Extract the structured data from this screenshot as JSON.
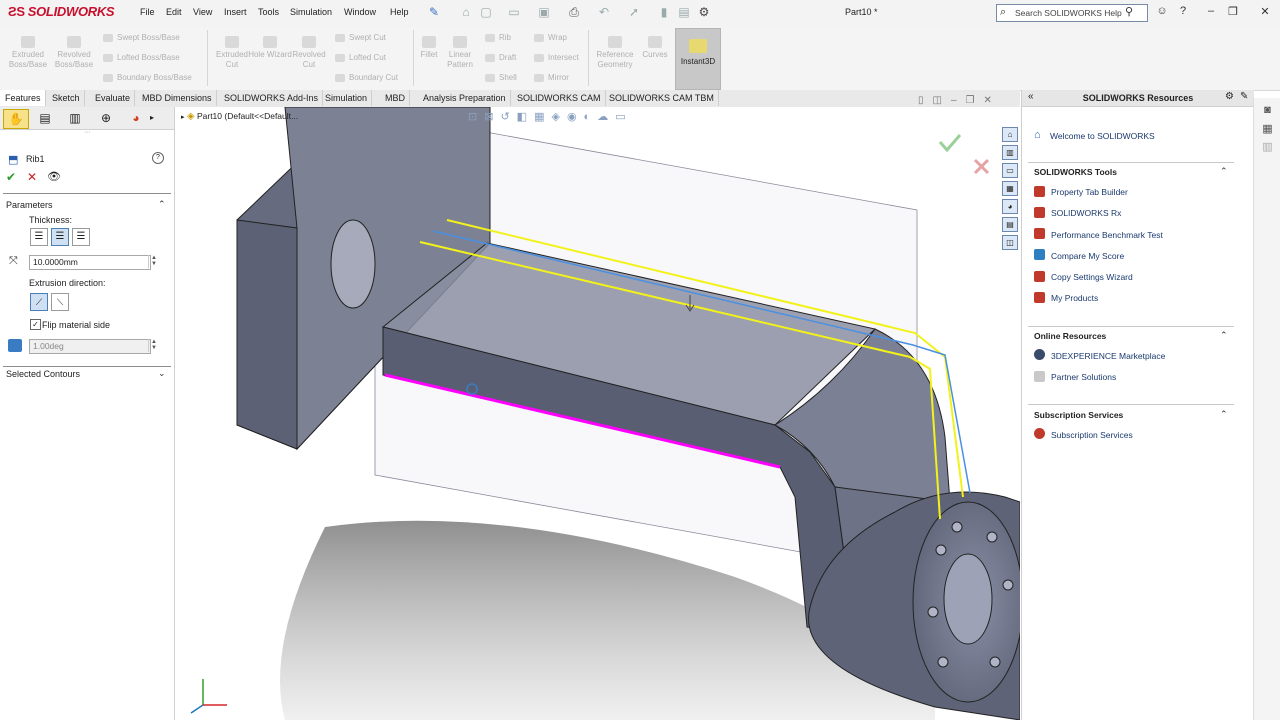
{
  "app": {
    "brand": "SOLIDWORKS",
    "brand_color": "#c8102e"
  },
  "menu": [
    "File",
    "Edit",
    "View",
    "Insert",
    "Tools",
    "Simulation",
    "Window",
    "Help"
  ],
  "document_title": "Part10 *",
  "search": {
    "placeholder": "Search SOLIDWORKS Help"
  },
  "commands": {
    "extruded_boss": "Extruded Boss/Base",
    "revolved_boss": "Revolved Boss/Base",
    "swept_boss": "Swept Boss/Base",
    "lofted_boss": "Lofted Boss/Base",
    "boundary_boss": "Boundary Boss/Base",
    "extruded_cut": "Extruded Cut",
    "hole_wizard": "Hole Wizard",
    "revolved_cut": "Revolved Cut",
    "swept_cut": "Swept Cut",
    "lofted_cut": "Lofted Cut",
    "boundary_cut": "Boundary Cut",
    "fillet": "Fillet",
    "linear_pattern": "Linear Pattern",
    "rib": "Rib",
    "draft": "Draft",
    "shell": "Shell",
    "wrap": "Wrap",
    "intersect": "Intersect",
    "mirror": "Mirror",
    "reference_geometry": "Reference Geometry",
    "curves": "Curves",
    "instant3d": "Instant3D"
  },
  "tabs": [
    "Features",
    "Sketch",
    "Evaluate",
    "MBD Dimensions",
    "SOLIDWORKS Add-Ins",
    "Simulation",
    "MBD",
    "Analysis Preparation",
    "SOLIDWORKS CAM",
    "SOLIDWORKS CAM TBM"
  ],
  "property_manager": {
    "feature_name": "Rib1",
    "parameters_header": "Parameters",
    "thickness_label": "Thickness:",
    "thickness_value": "10.0000mm",
    "extrusion_direction_label": "Extrusion direction:",
    "flip_material_label": "Flip material side",
    "flip_material_checked": true,
    "draft_value": "1.00deg",
    "selected_contours_header": "Selected Contours"
  },
  "feature_tree": {
    "root": "Part10",
    "config": "(Default<<Default..."
  },
  "resources": {
    "title": "SOLIDWORKS Resources",
    "welcome": "Welcome to SOLIDWORKS",
    "tools_header": "SOLIDWORKS Tools",
    "tools": [
      "Property Tab Builder",
      "SOLIDWORKS Rx",
      "Performance Benchmark Test",
      "Compare My Score",
      "Copy Settings Wizard",
      "My Products"
    ],
    "online_header": "Online Resources",
    "online": [
      "3DEXPERIENCE Marketplace",
      "Partner Solutions"
    ],
    "subscription_header": "Subscription Services",
    "subscription": [
      "Subscription Services"
    ]
  },
  "colors": {
    "selection_magenta": "#ff00ff",
    "sketch_yellow": "#f2f21a",
    "sketch_blue": "#4a90e2",
    "part_gray": "#6e7387"
  },
  "icons": [
    "search-icon",
    "user-icon",
    "help-icon",
    "home-icon",
    "new-icon",
    "open-icon",
    "save-icon",
    "print-icon",
    "undo-icon",
    "select-icon",
    "rebuild-icon",
    "options-icon",
    "pushpin-icon",
    "ok-icon",
    "cancel-icon",
    "preview-icon",
    "help-circle-icon",
    "chevron-up-icon",
    "chevron-down-icon",
    "triad-icon"
  ]
}
